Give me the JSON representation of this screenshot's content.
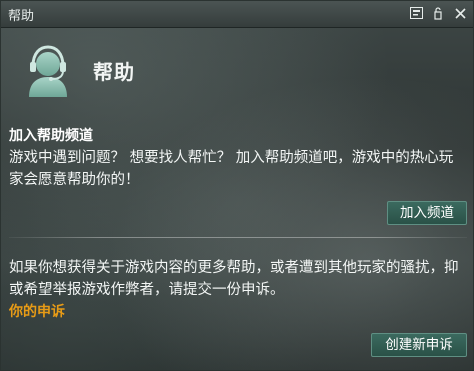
{
  "window": {
    "title": "帮助"
  },
  "header": {
    "title": "帮助",
    "avatar_icon": "support-headset-icon"
  },
  "join_section": {
    "title": "加入帮助频道",
    "description": "游戏中遇到问题？ 想要找人帮忙？ 加入帮助频道吧，游戏中的热心玩家会愿意帮助你的！",
    "button_label": "加入频道"
  },
  "report_section": {
    "description": "如果你想获得关于游戏内容的更多帮助，或者遭到其他玩家的骚扰，抑或希望举报游戏作弊者，请提交一份申诉。",
    "link_label": "你的申诉",
    "link_color": "#e79b16",
    "button_label": "创建新申诉"
  },
  "titlebar_icons": [
    "screenshot-icon",
    "pin-icon",
    "close-icon"
  ]
}
